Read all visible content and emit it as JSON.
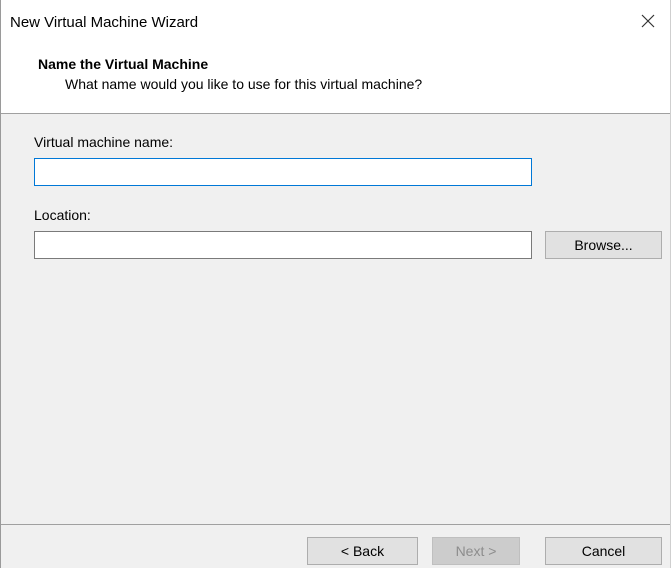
{
  "window": {
    "title": "New Virtual Machine Wizard",
    "close_icon": "close-icon"
  },
  "header": {
    "title": "Name the Virtual Machine",
    "subtitle": "What name would you like to use for this virtual machine?"
  },
  "form": {
    "vm_name_label": "Virtual machine name:",
    "vm_name_value": "",
    "location_label": "Location:",
    "location_value": "",
    "browse_label": "Browse..."
  },
  "footer": {
    "back_label": "< Back",
    "next_label": "Next >",
    "cancel_label": "Cancel"
  },
  "colors": {
    "focus_border": "#0078d7",
    "dialog_background": "#f0f0f0"
  }
}
